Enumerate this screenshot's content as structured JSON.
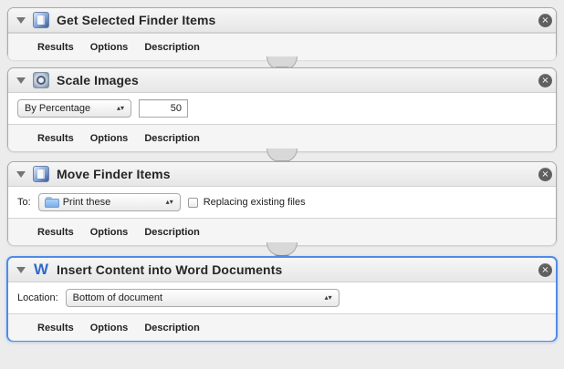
{
  "workflow": {
    "actions": [
      {
        "title": "Get Selected Finder Items",
        "icon": "finder-icon",
        "footer": [
          "Results",
          "Options",
          "Description"
        ]
      },
      {
        "title": "Scale Images",
        "icon": "preview-icon",
        "controls": {
          "scale_mode": "By Percentage",
          "scale_value": "50"
        },
        "footer": [
          "Results",
          "Options",
          "Description"
        ]
      },
      {
        "title": "Move Finder Items",
        "icon": "finder-icon",
        "controls": {
          "to_label": "To:",
          "destination": "Print these",
          "replace_label": "Replacing existing files",
          "replace_checked": false
        },
        "footer": [
          "Results",
          "Options",
          "Description"
        ]
      },
      {
        "title": "Insert Content into Word Documents",
        "icon": "word-icon",
        "controls": {
          "location_label": "Location:",
          "location_value": "Bottom of document"
        },
        "footer": [
          "Results",
          "Options",
          "Description"
        ],
        "selected": true
      }
    ]
  },
  "icons": {
    "close": "×",
    "word": "W",
    "popup_arrows": "▴▾"
  },
  "colors": {
    "selection_blue": "#4f8be8",
    "background": "#ececec"
  }
}
